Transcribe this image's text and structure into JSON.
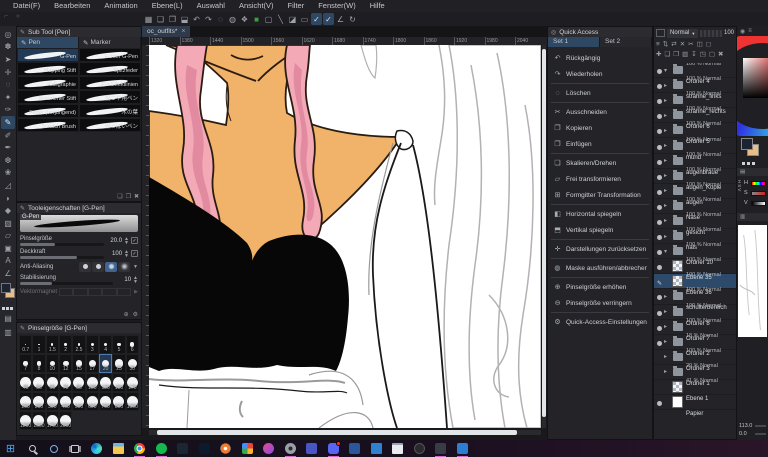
{
  "menu": {
    "items": [
      "Datei(F)",
      "Bearbeiten",
      "Animation",
      "Ebene(L)",
      "Auswahl",
      "Ansicht(V)",
      "Filter",
      "Fenster(W)",
      "Hilfe"
    ]
  },
  "toolbar": {
    "icons": [
      {
        "name": "show-grid",
        "glyph": "▦"
      },
      {
        "name": "new-canvas",
        "glyph": "❏"
      },
      {
        "name": "open-file",
        "glyph": "❐"
      },
      {
        "name": "save-file",
        "glyph": "⬓"
      },
      {
        "name": "undo",
        "glyph": "↶"
      },
      {
        "name": "redo",
        "glyph": "↷"
      },
      {
        "name": "deselect",
        "glyph": "◌"
      },
      {
        "name": "reselect",
        "glyph": "◍"
      },
      {
        "name": "clear-selection",
        "glyph": "❖"
      },
      {
        "name": "fill-color",
        "glyph": "■",
        "style": "color:#3f9d44"
      },
      {
        "name": "selection-border",
        "glyph": "▢"
      },
      {
        "name": "straight-line",
        "glyph": "╲"
      },
      {
        "name": "tone",
        "glyph": "◪"
      },
      {
        "name": "frame",
        "glyph": "▭"
      },
      {
        "name": "snap-to-ruler",
        "glyph": "✓",
        "active": true
      },
      {
        "name": "snap-to-special-ruler",
        "glyph": "✓",
        "active": true
      },
      {
        "name": "snap-to-grid",
        "glyph": "∠"
      },
      {
        "name": "rotate-reset",
        "glyph": "↻"
      }
    ]
  },
  "toolstrip": {
    "tools": [
      {
        "name": "zoom-tool",
        "glyph": "◎"
      },
      {
        "name": "hand-tool",
        "glyph": "✽"
      },
      {
        "name": "operation-tool",
        "glyph": "➤"
      },
      {
        "name": "move-layer-tool",
        "glyph": "✛"
      },
      {
        "name": "selection-tool",
        "glyph": "◌"
      },
      {
        "name": "auto-select-tool",
        "glyph": "✦"
      },
      {
        "name": "eyedropper-tool",
        "glyph": "✑"
      },
      {
        "name": "pen-tool",
        "glyph": "✎",
        "active": true
      },
      {
        "name": "pencil-tool",
        "glyph": "✐"
      },
      {
        "name": "brush-tool",
        "glyph": "✒"
      },
      {
        "name": "airbrush-tool",
        "glyph": "❆"
      },
      {
        "name": "decoration-tool",
        "glyph": "❀"
      },
      {
        "name": "eraser-tool",
        "glyph": "◿"
      },
      {
        "name": "blend-tool",
        "glyph": "◗"
      },
      {
        "name": "fill-tool",
        "glyph": "◆"
      },
      {
        "name": "gradient-tool",
        "glyph": "▨"
      },
      {
        "name": "figure-tool",
        "glyph": "▱"
      },
      {
        "name": "frame-border-tool",
        "glyph": "▣"
      },
      {
        "name": "text-tool",
        "glyph": "A"
      },
      {
        "name": "ruler-tool",
        "glyph": "∠"
      }
    ],
    "extra": [
      {
        "name": "selection-launcher",
        "glyph": "▤"
      },
      {
        "name": "material-strip",
        "glyph": "▥"
      }
    ]
  },
  "sub_tool": {
    "title": "Sub Tool [Pen]",
    "tabs": [
      {
        "label": "Pen",
        "selected": true
      },
      {
        "label": "Marker"
      }
    ],
    "brushes": [
      {
        "name": "G-Pen",
        "selected": true
      },
      {
        "name": "Echter G-Pen"
      },
      {
        "name": "Mapping Stift"
      },
      {
        "name": "Spitzfeder"
      },
      {
        "name": "Kalligraphie"
      },
      {
        "name": "Für Effektlinien"
      },
      {
        "name": "Texturierter Stift"
      },
      {
        "name": "髪つや用ペン"
      },
      {
        "name": "Feder (verjüngend)"
      },
      {
        "name": "木の葉"
      },
      {
        "name": "Scratch Brush"
      },
      {
        "name": "粉っぽいペン"
      }
    ],
    "foot_icons": [
      {
        "name": "new-sub-tool",
        "glyph": "❏"
      },
      {
        "name": "duplicate-sub-tool",
        "glyph": "❐"
      },
      {
        "name": "delete-sub-tool",
        "glyph": "✖"
      }
    ]
  },
  "tool_property": {
    "title": "Tooleigenschaften [G-Pen]",
    "tool_name": "G-Pen",
    "brush_size_label": "Pinselgröße",
    "brush_size_value": "20.0",
    "opacity_label": "Deckkraft",
    "opacity_value": "100",
    "anti_aliasing_label": "Anti-Aliasing",
    "stabilization_label": "Stabilisierung",
    "stabilization_value": "10",
    "vector_magnet_label": "Vektormagnet",
    "foot_icons": [
      {
        "name": "add-setting",
        "glyph": "⊕"
      },
      {
        "name": "detail-settings-wrench",
        "glyph": "⚙"
      }
    ]
  },
  "brush_size_panel": {
    "title": "Pinselgröße [G-Pen]",
    "sizes": [
      {
        "v": "0.7"
      },
      {
        "v": "1"
      },
      {
        "v": "1.5"
      },
      {
        "v": "2"
      },
      {
        "v": "2.5"
      },
      {
        "v": "3"
      },
      {
        "v": "4"
      },
      {
        "v": "5"
      },
      {
        "v": "6"
      },
      {
        "v": "7"
      },
      {
        "v": "8"
      },
      {
        "v": "10"
      },
      {
        "v": "12"
      },
      {
        "v": "15"
      },
      {
        "v": "17"
      },
      {
        "v": "20",
        "selected": true
      },
      {
        "v": "25"
      },
      {
        "v": "30"
      },
      {
        "v": "40"
      },
      {
        "v": "50"
      },
      {
        "v": "60"
      },
      {
        "v": "70"
      },
      {
        "v": "80"
      },
      {
        "v": "100"
      },
      {
        "v": "120"
      },
      {
        "v": "150"
      },
      {
        "v": "170"
      },
      {
        "v": "200"
      },
      {
        "v": "250"
      },
      {
        "v": "300"
      },
      {
        "v": "400"
      },
      {
        "v": "500"
      },
      {
        "v": "600"
      },
      {
        "v": "700"
      },
      {
        "v": "800"
      },
      {
        "v": "1000"
      },
      {
        "v": "1200"
      },
      {
        "v": "1500"
      },
      {
        "v": "1700"
      },
      {
        "v": "2000"
      }
    ]
  },
  "canvas": {
    "tab_label": "oc_outfits*",
    "close_glyph": "×",
    "ruler_ticks": [
      "1320",
      "1380",
      "1440",
      "1500",
      "1560",
      "1620",
      "1680",
      "1740",
      "1800",
      "1860",
      "1920",
      "1980",
      "2040"
    ]
  },
  "quick_access": {
    "title": "Quick Access",
    "header_icon": "◎",
    "tabs": [
      {
        "label": "Set 1",
        "selected": true
      },
      {
        "label": "Set 2"
      }
    ],
    "items": [
      {
        "label": "Rückgängig",
        "glyph": "↶",
        "name": "undo"
      },
      {
        "label": "Wiederholen",
        "glyph": "↷",
        "name": "redo",
        "disabled": true
      },
      {
        "sep": true
      },
      {
        "label": "Löschen",
        "glyph": "◌",
        "name": "delete"
      },
      {
        "sep": true
      },
      {
        "label": "Ausschneiden",
        "glyph": "✂",
        "name": "cut"
      },
      {
        "label": "Kopieren",
        "glyph": "❐",
        "name": "copy"
      },
      {
        "label": "Einfügen",
        "glyph": "❒",
        "name": "paste"
      },
      {
        "sep": true
      },
      {
        "label": "Skalieren/Drehen",
        "glyph": "❏",
        "name": "scale-rotate"
      },
      {
        "label": "Frei transformieren",
        "glyph": "▱",
        "name": "free-transform"
      },
      {
        "label": "Formgitter Transformation",
        "glyph": "⊞",
        "name": "mesh-transform"
      },
      {
        "sep": true
      },
      {
        "label": "Horizontal spiegeln",
        "glyph": "◧",
        "name": "flip-horizontal"
      },
      {
        "label": "Vertikal spiegeln",
        "glyph": "⬒",
        "name": "flip-vertical"
      },
      {
        "sep": true
      },
      {
        "label": "Darstellungen zurücksetzen",
        "glyph": "✛",
        "name": "reset-display"
      },
      {
        "sep": true
      },
      {
        "label": "Maske ausführen/abbrechen",
        "glyph": "◍",
        "name": "apply-cancel-mask"
      },
      {
        "sep": true
      },
      {
        "label": "Pinselgröße erhöhen",
        "glyph": "⊕",
        "name": "brush-size-increase"
      },
      {
        "label": "Pinselgröße verringern",
        "glyph": "⊖",
        "name": "brush-size-decrease"
      },
      {
        "sep": true
      },
      {
        "label": "Quick-Access-Einstellungen",
        "glyph": "⚙",
        "name": "quick-access-settings"
      }
    ]
  },
  "layers": {
    "blend_mode": "Normal",
    "opacity_value": "100",
    "icon_row1": [
      "≡",
      "⇅",
      "⇄",
      "✕",
      "✂",
      "◫",
      "◻"
    ],
    "icon_row2": [
      "✚",
      "❏",
      "❐",
      "▥",
      "↧",
      "◳",
      "▢",
      "✖"
    ],
    "items": [
      {
        "meta": "100 % Normal",
        "name": "Ordner 4",
        "kind": "folder",
        "arrow": "▾",
        "visible": true
      },
      {
        "meta": "100 % Normal",
        "name": "strähne_links",
        "kind": "folder",
        "arrow": "▸",
        "visible": true
      },
      {
        "meta": "100 % Normal",
        "name": "strähne_rechts",
        "kind": "folder",
        "arrow": "▸",
        "visible": true
      },
      {
        "meta": "100 % Normal",
        "name": "Ordner 6",
        "kind": "folder",
        "arrow": "▸",
        "visible": true
      },
      {
        "meta": "100 % Normal",
        "name": "Ordner 5",
        "kind": "folder",
        "arrow": "▸",
        "visible": true
      },
      {
        "meta": "100 % Normal",
        "name": "mund",
        "kind": "folder",
        "arrow": "▸",
        "visible": true
      },
      {
        "meta": "100 % Normal",
        "name": "augenbraue",
        "kind": "folder",
        "arrow": "▸",
        "visible": true
      },
      {
        "meta": "100 % Normal",
        "name": "augen_Kopie",
        "kind": "folder",
        "arrow": "▸",
        "visible": true
      },
      {
        "meta": "100 % Normal",
        "name": "augen",
        "kind": "folder",
        "arrow": "▸",
        "visible": true
      },
      {
        "meta": "100 % Normal",
        "name": "Nase",
        "kind": "folder",
        "arrow": "▸",
        "visible": true
      },
      {
        "meta": "100 % Normal",
        "name": "gesicht",
        "kind": "folder",
        "arrow": "▸",
        "visible": true
      },
      {
        "meta": "100 % Normal",
        "name": "hals",
        "kind": "folder",
        "arrow": "▸",
        "visible": true
      },
      {
        "meta": "100 % Normal",
        "name": "Ordner 10",
        "kind": "folder",
        "arrow": "▾",
        "visible": true
      },
      {
        "meta": "100 % Normal",
        "name": "Ebene 35",
        "kind": "checker",
        "child": true,
        "visible": true
      },
      {
        "meta": "100 % Normal",
        "name": "Ebene 36",
        "kind": "checker",
        "child": true,
        "selected": true,
        "editing": true,
        "visible": true
      },
      {
        "meta": "100 % Normal",
        "name": "schulterbereich",
        "kind": "folder",
        "arrow": "▸",
        "visible": true
      },
      {
        "meta": "100 % Normal",
        "name": "Ordner 8",
        "kind": "folder",
        "arrow": "▸",
        "visible": true
      },
      {
        "meta": "100 % Normal",
        "name": "Ordner 7",
        "kind": "folder",
        "arrow": "▸",
        "visible": true
      },
      {
        "meta": "18 % Normal",
        "name": "Ordner 2",
        "kind": "folder",
        "arrow": "▸",
        "visible": true
      },
      {
        "meta": "100 % Normal",
        "name": "Ordner 3",
        "kind": "folder",
        "arrow": "▸",
        "visible": false
      },
      {
        "meta": "29 % Normal",
        "name": "Ordner 1",
        "kind": "folder",
        "arrow": "▸",
        "visible": false
      },
      {
        "meta": "41 % Normal",
        "name": "Ebene 1",
        "kind": "checker",
        "visible": false
      },
      {
        "meta": "",
        "name": "Papier",
        "kind": "paper",
        "visible": true
      }
    ]
  },
  "color_panel": {
    "foreground": "#1c2433",
    "background": "#e9bd86",
    "side_tab": "HSV",
    "h_label": "H",
    "s_label": "S",
    "v_label": "V"
  },
  "navigator": {
    "zoom_value": "113.0",
    "rotation_value": "0.0"
  },
  "taskbar": {
    "items": [
      {
        "name": "start",
        "glyph": "⊞"
      },
      {
        "name": "search"
      },
      {
        "name": "cortana"
      },
      {
        "name": "task-view"
      },
      {
        "name": "edge"
      },
      {
        "name": "file-explorer"
      },
      {
        "name": "chrome",
        "running": true
      },
      {
        "name": "spotify",
        "running": true
      },
      {
        "name": "lightroom",
        "label": "Lr"
      },
      {
        "name": "photoshop",
        "label": "Ps"
      },
      {
        "name": "blender"
      },
      {
        "name": "photos"
      },
      {
        "name": "paint3d"
      },
      {
        "name": "settings",
        "running": true
      },
      {
        "name": "teams"
      },
      {
        "name": "discord",
        "running": true,
        "badge": true,
        "active": true
      },
      {
        "name": "word",
        "label": "W"
      },
      {
        "name": "vscode"
      },
      {
        "name": "notepad"
      },
      {
        "name": "epic"
      },
      {
        "name": "clip-studio",
        "label": "✒",
        "running": true
      },
      {
        "name": "photo-app",
        "label": "▲",
        "running": true
      }
    ]
  },
  "art": {
    "canvas_bg": "#ffffff",
    "skin": "#f1b269",
    "outline": "#2a1c10",
    "hair_pink": "#f3a9b6",
    "hair_pink_shade": "#e18aa0",
    "hair_white_line": "#b2b2b4",
    "top_black": "#070707",
    "line_dark": "#1a1a1a",
    "line_gray": "#9a9a9c"
  }
}
